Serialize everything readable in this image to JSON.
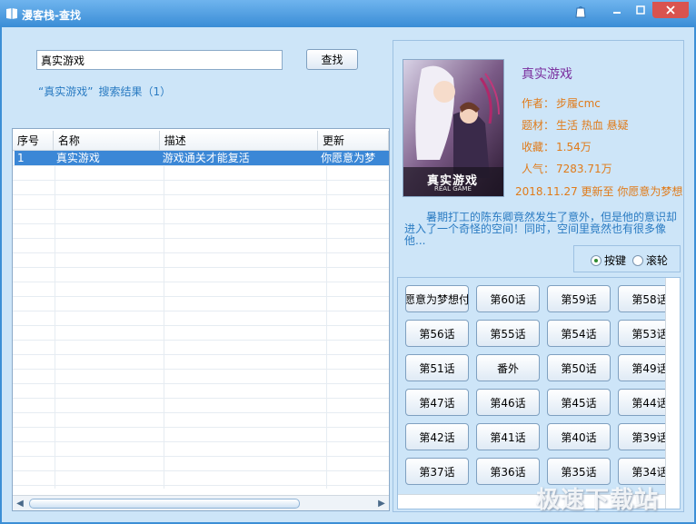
{
  "window": {
    "title": "漫客栈-查找",
    "accent": "#3a8dd6"
  },
  "search": {
    "value": "真实游戏",
    "button_label": "查找",
    "result_query": "“真实游戏”",
    "result_text": "搜索结果（1）"
  },
  "list": {
    "columns": [
      "序号",
      "名称",
      "描述",
      "更新"
    ],
    "rows": [
      [
        "1",
        "真实游戏",
        "游戏通关才能复活",
        "你愿意为梦"
      ]
    ]
  },
  "detail": {
    "title": "真实游戏",
    "author_label": "作者：",
    "author": "步履cmc",
    "theme_label": "题材：",
    "theme": "生活 热血 悬疑",
    "fav_label": "收藏：",
    "fav": "1.54万",
    "pop_label": "人气：",
    "pop": "7283.71万",
    "update": "2018.11.27 更新至 你愿意为梦想付",
    "description": "暑期打工的陈东卿竟然发生了意外，但是他的意识却进入了一个奇怪的空间！同时，空间里竟然也有很多像他...",
    "cover_text": "真实游戏",
    "cover_sub": "REAL GAME"
  },
  "mode": {
    "option1": "按键",
    "option2": "滚轮",
    "selected": "按键"
  },
  "chapters": [
    "你愿意为梦想付出",
    "第60话",
    "第59话",
    "第58话",
    "第56话",
    "第55话",
    "第54话",
    "第53话",
    "第51话",
    "番外",
    "第50话",
    "第49话",
    "第47话",
    "第46话",
    "第45话",
    "第44话",
    "第42话",
    "第41话",
    "第40话",
    "第39话",
    "第37话",
    "第36话",
    "第35话",
    "第34话"
  ],
  "watermark": "极速下载站"
}
